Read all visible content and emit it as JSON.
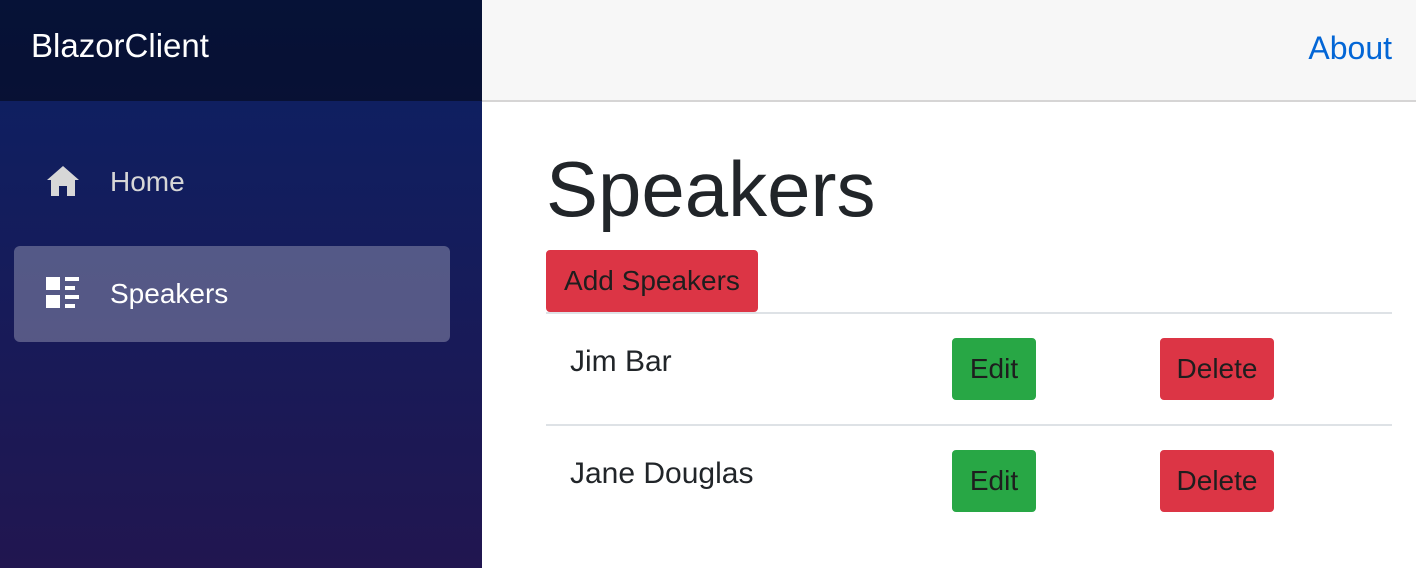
{
  "sidebar": {
    "brand": "BlazorClient",
    "items": [
      {
        "label": "Home",
        "icon": "home-icon",
        "active": false
      },
      {
        "label": "Speakers",
        "icon": "list-rich-icon",
        "active": true
      }
    ]
  },
  "topbar": {
    "about_label": "About"
  },
  "main": {
    "title": "Speakers",
    "add_button_label": "Add Speakers",
    "rows": [
      {
        "name": "Jim Bar",
        "edit_label": "Edit",
        "delete_label": "Delete"
      },
      {
        "name": "Jane Douglas",
        "edit_label": "Edit",
        "delete_label": "Delete"
      }
    ]
  },
  "colors": {
    "sidebar_top": "#0b2164",
    "sidebar_bottom": "#211650",
    "link": "#0366d6",
    "danger": "#dc3545",
    "success": "#28a745"
  }
}
